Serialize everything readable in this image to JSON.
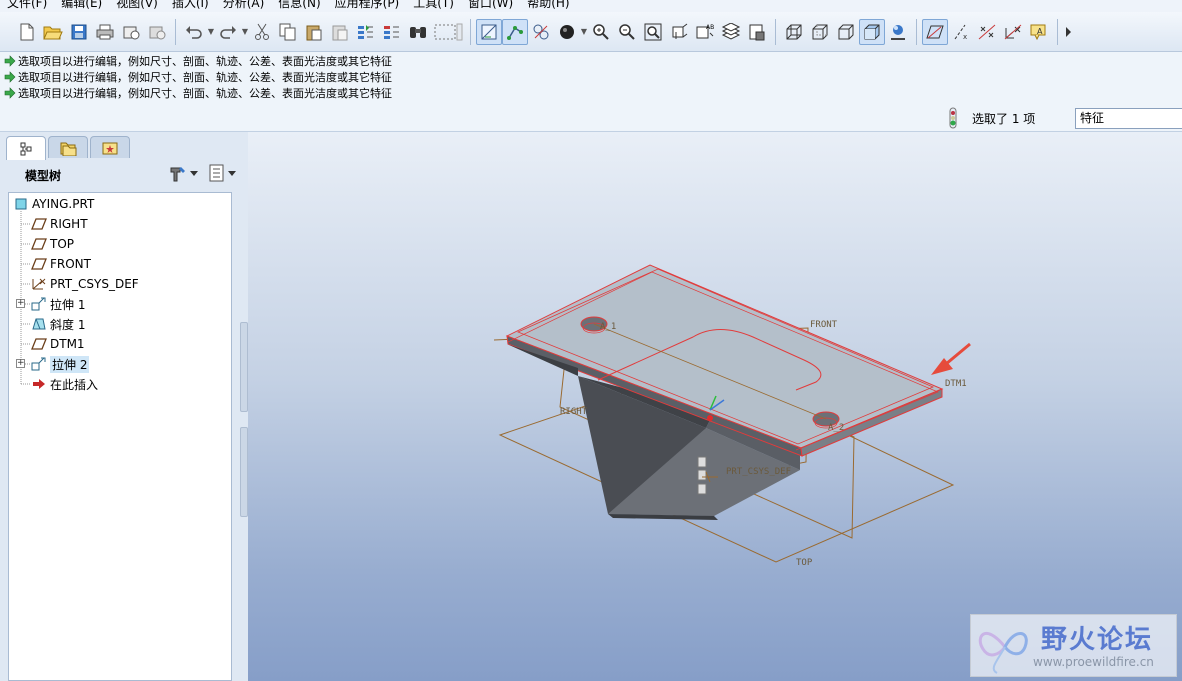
{
  "menubar": {
    "items": [
      "文件(F)",
      "编辑(E)",
      "视图(V)",
      "插入(I)",
      "分析(A)",
      "信息(N)",
      "应用程序(P)",
      "工具(T)",
      "窗口(W)",
      "帮助(H)"
    ]
  },
  "toolbar": {
    "buttons": [
      "new-icon",
      "open-icon",
      "save-icon",
      "print-icon",
      "send-mail-icon",
      "send-mail-attach-icon",
      "undo-icon",
      "redo-icon",
      "cut-icon",
      "copy-icon",
      "paste-icon",
      "paste-special-icon",
      "regenerate-icon",
      "regen-manager-icon",
      "find-icon",
      "select-box-icon",
      "datum-plane-toggle-icon",
      "datum-axis-toggle-icon",
      "datum-point-toggle-icon",
      "spin-center-icon",
      "zoom-in-icon",
      "zoom-out-icon",
      "refit-icon",
      "reorient-icon",
      "saved-views-icon",
      "layers-icon",
      "view-manager-icon",
      "wireframe-icon",
      "hidden-line-icon",
      "no-hidden-icon",
      "shading-icon",
      "enhanced-realism-icon",
      "plane-display-icon",
      "axis-display-icon",
      "point-display-icon",
      "csys-display-icon",
      "annotation-display-icon"
    ],
    "active": [
      "datum-plane-toggle-icon",
      "datum-axis-toggle-icon",
      "shading-icon"
    ]
  },
  "messages": [
    "选取项目以进行编辑，例如尺寸、剖面、轨迹、公差、表面光洁度或其它特征",
    "选取项目以进行编辑，例如尺寸、剖面、轨迹、公差、表面光洁度或其它特征",
    "选取项目以进行编辑，例如尺寸、剖面、轨迹、公差、表面光洁度或其它特征"
  ],
  "status": {
    "selected_text": "选取了 1 项",
    "filter_value": "特征"
  },
  "panel": {
    "tabs": [
      "model-tree-tab",
      "folder-browser-tab",
      "favorites-tab"
    ],
    "title": "模型树"
  },
  "tree": {
    "root": "AYING.PRT",
    "items": [
      {
        "label": "RIGHT",
        "icon": "datum-plane-icon",
        "expandable": false,
        "highlight": false
      },
      {
        "label": "TOP",
        "icon": "datum-plane-icon",
        "expandable": false,
        "highlight": false
      },
      {
        "label": "FRONT",
        "icon": "datum-plane-icon",
        "expandable": false,
        "highlight": false
      },
      {
        "label": "PRT_CSYS_DEF",
        "icon": "csys-icon",
        "expandable": false,
        "highlight": false
      },
      {
        "label": "拉伸 1",
        "icon": "extrude-icon",
        "expandable": true,
        "highlight": false
      },
      {
        "label": "斜度 1",
        "icon": "draft-icon",
        "expandable": false,
        "highlight": false
      },
      {
        "label": "DTM1",
        "icon": "datum-plane-icon",
        "expandable": false,
        "highlight": false
      },
      {
        "label": "拉伸 2",
        "icon": "extrude-icon",
        "expandable": true,
        "highlight": true
      },
      {
        "label": "在此插入",
        "icon": "insert-here-arrow-icon",
        "expandable": false,
        "highlight": false
      }
    ]
  },
  "viewport": {
    "datum_labels": [
      "FRONT",
      "DTM1",
      "RIGHT",
      "TOP",
      "PRT_CSYS_DEF",
      "A_1",
      "A_2"
    ]
  },
  "watermark": {
    "title": "野火论坛",
    "url": "www.proewildfire.cn"
  }
}
